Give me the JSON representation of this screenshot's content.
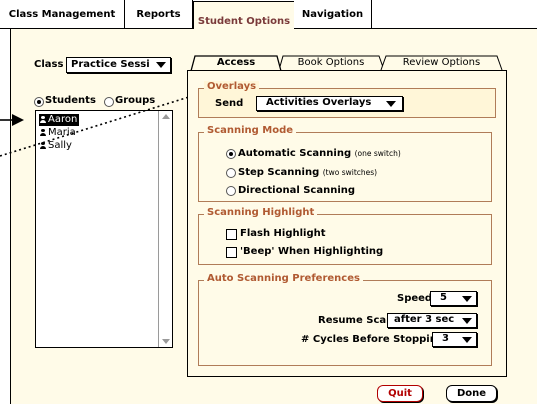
{
  "top_tabs": [
    {
      "label": "Class Management"
    },
    {
      "label": "Reports"
    },
    {
      "label": "Student Options"
    },
    {
      "label": "Navigation"
    }
  ],
  "class_row": {
    "label": "Class",
    "value": "Practice Sessi"
  },
  "mode": {
    "students_label": "Students",
    "groups_label": "Groups"
  },
  "students": [
    "Aaron",
    "Maria",
    "Sally"
  ],
  "inner_tabs": [
    {
      "label": "Access"
    },
    {
      "label": "Book Options"
    },
    {
      "label": "Review Options"
    }
  ],
  "overlays": {
    "title": "Overlays",
    "send_label": "Send",
    "send_value": "Activities Overlays"
  },
  "scanning_mode": {
    "title": "Scanning Mode",
    "options": [
      {
        "label": "Automatic Scanning",
        "note": "(one switch)"
      },
      {
        "label": "Step Scanning",
        "note": "(two switches)"
      },
      {
        "label": "Directional Scanning",
        "note": ""
      }
    ]
  },
  "scanning_highlight": {
    "title": "Scanning Highlight",
    "options": [
      {
        "label": "Flash Highlight"
      },
      {
        "label": "'Beep' When Highlighting"
      }
    ]
  },
  "auto_prefs": {
    "title": "Auto Scanning Preferences",
    "speed_label": "Speed",
    "speed_value": "5",
    "resume_label": "Resume Scan",
    "resume_value": "after 3 sec",
    "cycles_label": "# Cycles Before Stopping",
    "cycles_value": "3"
  },
  "buttons": {
    "quit": "Quit",
    "done": "Done"
  },
  "colors": {
    "panel_bg": "#fffbe8",
    "group_title": "#b05a32",
    "quit": "#b20000"
  }
}
